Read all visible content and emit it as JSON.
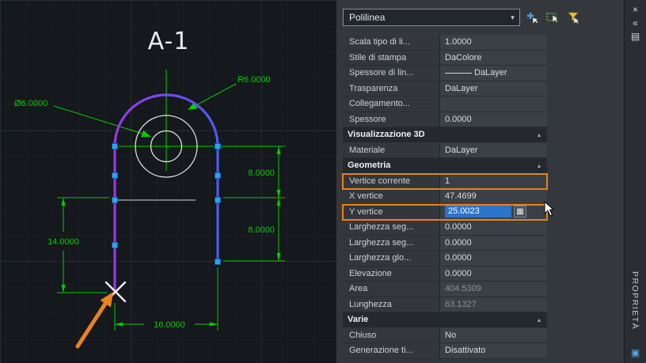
{
  "canvas": {
    "title": "A-1",
    "dimensions": {
      "diameter": "Ø6.0000",
      "radius": "R6.0000",
      "right_top": "8.0000",
      "right_bottom": "8.0000",
      "left_height": "14.0000",
      "bottom_width": "16.0000"
    }
  },
  "palette": {
    "selector_value": "Polilinea",
    "title": "PROPRIETÀ",
    "rows": [
      {
        "label": "Scala tipo di li...",
        "value": "1.0000"
      },
      {
        "label": "Stile di stampa",
        "value": "DaColore"
      },
      {
        "label": "Spessore di lin...",
        "value": "DaLayer",
        "line_sample": true
      },
      {
        "label": "Trasparenza",
        "value": "DaLayer"
      },
      {
        "label": "Collegamento...",
        "value": ""
      },
      {
        "label": "Spessore",
        "value": "0.0000"
      },
      {
        "section": "Visualizzazione 3D"
      },
      {
        "label": "Materiale",
        "value": "DaLayer"
      },
      {
        "section": "Geometria"
      },
      {
        "label": "Vertice corrente",
        "value": "1",
        "highlight": true
      },
      {
        "label": "X vertice",
        "value": "47.4699"
      },
      {
        "label": "Y vertice",
        "value": "25.0023",
        "highlight": true,
        "selected": true
      },
      {
        "label": "Larghezza seg...",
        "value": "0.0000"
      },
      {
        "label": "Larghezza seg...",
        "value": "0.0000"
      },
      {
        "label": "Larghezza glo...",
        "value": "0.0000"
      },
      {
        "label": "Elevazione",
        "value": "0.0000"
      },
      {
        "label": "Area",
        "value": "404.5309",
        "dimmed": true
      },
      {
        "label": "Lunghezza",
        "value": "63.1327",
        "dimmed": true
      },
      {
        "section": "Varie"
      },
      {
        "label": "Chiuso",
        "value": "No"
      },
      {
        "label": "Generazione  ti...",
        "value": "Disattivato"
      }
    ]
  },
  "icons": {
    "close": "×",
    "autohide": "«",
    "menu": "▤",
    "dropdown": "▾",
    "section": "▴",
    "calculator": "▦",
    "anchor": "▣"
  },
  "colors": {
    "dimension": "#00cf00",
    "polyline_start": "#9a36e8",
    "polyline_end": "#4b5cf0",
    "grip": "#2da2f2",
    "highlight": "#e8821c",
    "selection": "#2b74cc",
    "annotation": "#e8831e"
  }
}
